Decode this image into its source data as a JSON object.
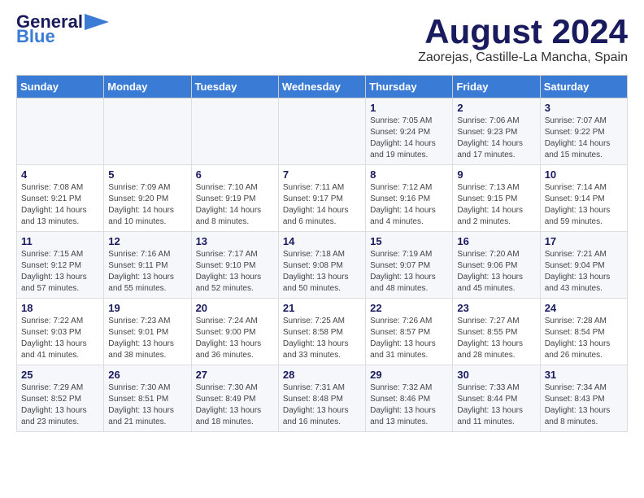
{
  "header": {
    "logo_line1": "General",
    "logo_line2": "Blue",
    "month_title": "August 2024",
    "location": "Zaorejas, Castille-La Mancha, Spain"
  },
  "columns": [
    "Sunday",
    "Monday",
    "Tuesday",
    "Wednesday",
    "Thursday",
    "Friday",
    "Saturday"
  ],
  "weeks": [
    [
      {
        "num": "",
        "info": ""
      },
      {
        "num": "",
        "info": ""
      },
      {
        "num": "",
        "info": ""
      },
      {
        "num": "",
        "info": ""
      },
      {
        "num": "1",
        "info": "Sunrise: 7:05 AM\nSunset: 9:24 PM\nDaylight: 14 hours\nand 19 minutes."
      },
      {
        "num": "2",
        "info": "Sunrise: 7:06 AM\nSunset: 9:23 PM\nDaylight: 14 hours\nand 17 minutes."
      },
      {
        "num": "3",
        "info": "Sunrise: 7:07 AM\nSunset: 9:22 PM\nDaylight: 14 hours\nand 15 minutes."
      }
    ],
    [
      {
        "num": "4",
        "info": "Sunrise: 7:08 AM\nSunset: 9:21 PM\nDaylight: 14 hours\nand 13 minutes."
      },
      {
        "num": "5",
        "info": "Sunrise: 7:09 AM\nSunset: 9:20 PM\nDaylight: 14 hours\nand 10 minutes."
      },
      {
        "num": "6",
        "info": "Sunrise: 7:10 AM\nSunset: 9:19 PM\nDaylight: 14 hours\nand 8 minutes."
      },
      {
        "num": "7",
        "info": "Sunrise: 7:11 AM\nSunset: 9:17 PM\nDaylight: 14 hours\nand 6 minutes."
      },
      {
        "num": "8",
        "info": "Sunrise: 7:12 AM\nSunset: 9:16 PM\nDaylight: 14 hours\nand 4 minutes."
      },
      {
        "num": "9",
        "info": "Sunrise: 7:13 AM\nSunset: 9:15 PM\nDaylight: 14 hours\nand 2 minutes."
      },
      {
        "num": "10",
        "info": "Sunrise: 7:14 AM\nSunset: 9:14 PM\nDaylight: 13 hours\nand 59 minutes."
      }
    ],
    [
      {
        "num": "11",
        "info": "Sunrise: 7:15 AM\nSunset: 9:12 PM\nDaylight: 13 hours\nand 57 minutes."
      },
      {
        "num": "12",
        "info": "Sunrise: 7:16 AM\nSunset: 9:11 PM\nDaylight: 13 hours\nand 55 minutes."
      },
      {
        "num": "13",
        "info": "Sunrise: 7:17 AM\nSunset: 9:10 PM\nDaylight: 13 hours\nand 52 minutes."
      },
      {
        "num": "14",
        "info": "Sunrise: 7:18 AM\nSunset: 9:08 PM\nDaylight: 13 hours\nand 50 minutes."
      },
      {
        "num": "15",
        "info": "Sunrise: 7:19 AM\nSunset: 9:07 PM\nDaylight: 13 hours\nand 48 minutes."
      },
      {
        "num": "16",
        "info": "Sunrise: 7:20 AM\nSunset: 9:06 PM\nDaylight: 13 hours\nand 45 minutes."
      },
      {
        "num": "17",
        "info": "Sunrise: 7:21 AM\nSunset: 9:04 PM\nDaylight: 13 hours\nand 43 minutes."
      }
    ],
    [
      {
        "num": "18",
        "info": "Sunrise: 7:22 AM\nSunset: 9:03 PM\nDaylight: 13 hours\nand 41 minutes."
      },
      {
        "num": "19",
        "info": "Sunrise: 7:23 AM\nSunset: 9:01 PM\nDaylight: 13 hours\nand 38 minutes."
      },
      {
        "num": "20",
        "info": "Sunrise: 7:24 AM\nSunset: 9:00 PM\nDaylight: 13 hours\nand 36 minutes."
      },
      {
        "num": "21",
        "info": "Sunrise: 7:25 AM\nSunset: 8:58 PM\nDaylight: 13 hours\nand 33 minutes."
      },
      {
        "num": "22",
        "info": "Sunrise: 7:26 AM\nSunset: 8:57 PM\nDaylight: 13 hours\nand 31 minutes."
      },
      {
        "num": "23",
        "info": "Sunrise: 7:27 AM\nSunset: 8:55 PM\nDaylight: 13 hours\nand 28 minutes."
      },
      {
        "num": "24",
        "info": "Sunrise: 7:28 AM\nSunset: 8:54 PM\nDaylight: 13 hours\nand 26 minutes."
      }
    ],
    [
      {
        "num": "25",
        "info": "Sunrise: 7:29 AM\nSunset: 8:52 PM\nDaylight: 13 hours\nand 23 minutes."
      },
      {
        "num": "26",
        "info": "Sunrise: 7:30 AM\nSunset: 8:51 PM\nDaylight: 13 hours\nand 21 minutes."
      },
      {
        "num": "27",
        "info": "Sunrise: 7:30 AM\nSunset: 8:49 PM\nDaylight: 13 hours\nand 18 minutes."
      },
      {
        "num": "28",
        "info": "Sunrise: 7:31 AM\nSunset: 8:48 PM\nDaylight: 13 hours\nand 16 minutes."
      },
      {
        "num": "29",
        "info": "Sunrise: 7:32 AM\nSunset: 8:46 PM\nDaylight: 13 hours\nand 13 minutes."
      },
      {
        "num": "30",
        "info": "Sunrise: 7:33 AM\nSunset: 8:44 PM\nDaylight: 13 hours\nand 11 minutes."
      },
      {
        "num": "31",
        "info": "Sunrise: 7:34 AM\nSunset: 8:43 PM\nDaylight: 13 hours\nand 8 minutes."
      }
    ]
  ]
}
